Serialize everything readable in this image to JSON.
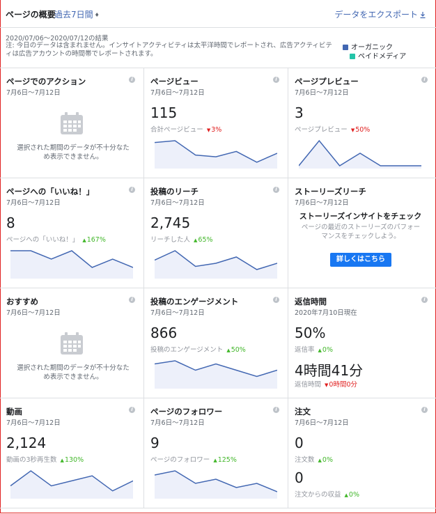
{
  "header": {
    "title": "ページの概要",
    "period": "過去7日間",
    "export": "データをエクスポート"
  },
  "info": {
    "range": "2020/07/06～2020/07/12の結果",
    "note": "注: 今日のデータは含まれません。インサイトアクティビティは太平洋時間でレポートされ、広告アクティビティは広告アカウントの時間帯でレポートされます。",
    "legend": [
      {
        "label": "オーガニック",
        "color": "#4267b2"
      },
      {
        "label": "ペイドメディア",
        "color": "#23c4a8"
      }
    ]
  },
  "cards": {
    "page_actions": {
      "title": "ページでのアクション",
      "date": "7月6日～7月12日",
      "empty": "選択された期間のデータが不十分なため表示できません。"
    },
    "page_views": {
      "title": "ページビュー",
      "date": "7月6日～7月12日",
      "value": "115",
      "sub": "合計ページビュー",
      "change": "3%",
      "trend": "down",
      "spark": [
        13,
        14,
        6,
        5,
        8,
        2,
        7
      ]
    },
    "page_previews": {
      "title": "ページプレビュー",
      "date": "7月6日～7月12日",
      "value": "3",
      "sub": "ページプレビュー",
      "change": "50%",
      "trend": "down",
      "spark": [
        0,
        2,
        0,
        1,
        0,
        0,
        0
      ]
    },
    "page_likes": {
      "title": "ページへの「いいね！」",
      "date": "7月6日～7月12日",
      "value": "8",
      "sub": "ページへの「いいね！」",
      "change": "167%",
      "trend": "up",
      "spark": [
        3,
        3,
        2,
        3,
        1,
        2,
        1
      ]
    },
    "post_reach": {
      "title": "投稿のリーチ",
      "date": "7月6日～7月12日",
      "value": "2,745",
      "sub": "リーチした人",
      "change": "65%",
      "trend": "up",
      "spark": [
        5,
        8,
        3,
        4,
        6,
        2,
        4
      ]
    },
    "stories_reach": {
      "title": "ストーリーズリーチ",
      "date": "7月6日～7月12日",
      "promo_title": "ストーリーズインサイトをチェック",
      "promo_text": "ページの最近のストーリーズのパフォーマンスをチェックしよう。",
      "button": "詳しくはこちら"
    },
    "recommendations": {
      "title": "おすすめ",
      "date": "7月6日～7月12日",
      "empty": "選択された期間のデータが不十分なため表示できません。"
    },
    "post_engagement": {
      "title": "投稿のエンゲージメント",
      "date": "7月6日～7月12日",
      "value": "866",
      "sub": "投稿のエンゲージメント",
      "change": "50%",
      "trend": "up",
      "spark": [
        7,
        8,
        5,
        7,
        5,
        3,
        5
      ]
    },
    "response_time": {
      "title": "返信時間",
      "date": "2020年7月10日現在",
      "value": "50%",
      "sub": "返信率",
      "change": "0%",
      "trend": "up",
      "value2": "4時間41分",
      "sub2": "返信時間",
      "change2": "0時間0分",
      "trend2": "down"
    },
    "videos": {
      "title": "動画",
      "date": "7月6日～7月12日",
      "value": "2,124",
      "sub": "動画の3秒再生数",
      "change": "130%",
      "trend": "up",
      "spark": [
        2,
        5,
        2,
        3,
        4,
        1,
        3
      ]
    },
    "page_followers": {
      "title": "ページのフォロワー",
      "date": "7月6日～7月12日",
      "value": "9",
      "sub": "ページのフォロワー",
      "change": "125%",
      "trend": "up",
      "spark": [
        5,
        6,
        3,
        4,
        2,
        3,
        1
      ]
    },
    "orders": {
      "title": "注文",
      "date": "7月6日～7月12日",
      "value": "0",
      "sub": "注文数",
      "change": "0%",
      "trend": "up",
      "value2": "0",
      "sub2": "注文からの収益",
      "change2": "0%",
      "trend2": "up"
    }
  }
}
